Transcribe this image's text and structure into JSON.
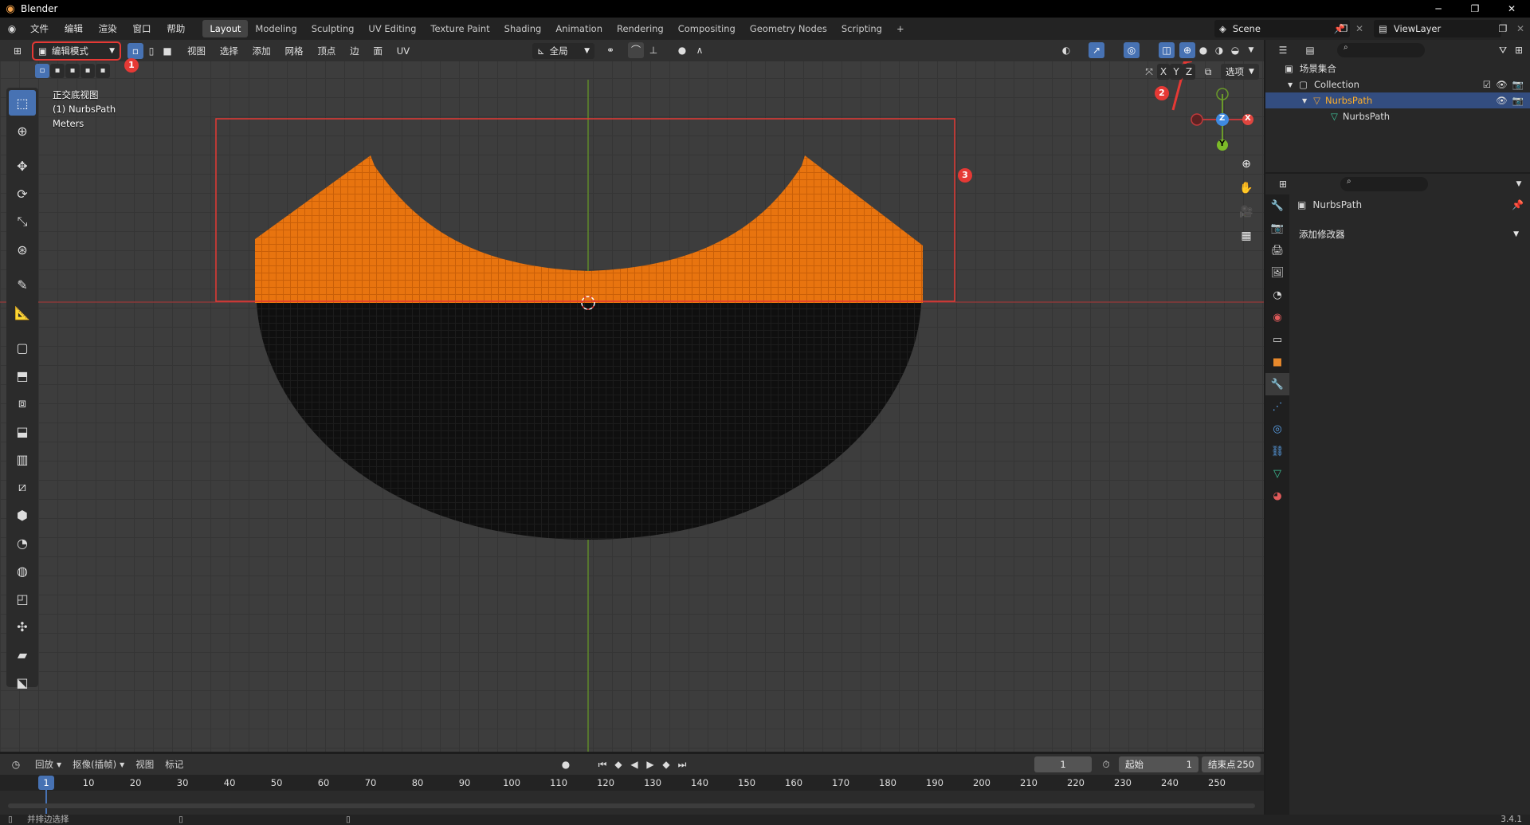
{
  "window": {
    "app_icon": "blender-logo-icon",
    "title": "Blender",
    "minimize": "─",
    "maximize": "❐",
    "close": "✕"
  },
  "menu": [
    "文件",
    "编辑",
    "渲染",
    "窗口",
    "帮助"
  ],
  "workspaces": [
    "Layout",
    "Modeling",
    "Sculpting",
    "UV Editing",
    "Texture Paint",
    "Shading",
    "Animation",
    "Rendering",
    "Compositing",
    "Geometry Nodes",
    "Scripting",
    "+"
  ],
  "scene": {
    "label": "Scene",
    "view_layer": "ViewLayer"
  },
  "viewport_header": {
    "mode": "编辑模式",
    "menus": [
      "视图",
      "选择",
      "添加",
      "网格",
      "顶点",
      "边",
      "面",
      "UV"
    ],
    "transform_orientation": "全局",
    "options": "选项",
    "axes": [
      "X",
      "Y",
      "Z"
    ]
  },
  "viewport_info": {
    "view": "正交底视图",
    "object": "(1) NurbsPath",
    "units": "Meters"
  },
  "gizmo": {
    "x": "X",
    "y": "Y",
    "z": "Z"
  },
  "annotations": [
    "1",
    "2",
    "3"
  ],
  "colors": {
    "selected": "#e8740f",
    "unselected": "#111111",
    "accent": "#4772b3",
    "annotation": "#e53935"
  },
  "timeline": {
    "playback": "回放",
    "keying": "抠像(插帧)",
    "view": "视图",
    "marker": "标记",
    "current_frame": "1",
    "start_label": "起始",
    "start": "1",
    "end_label": "结束点",
    "end": "250",
    "ruler": [
      "1",
      "10",
      "20",
      "30",
      "40",
      "50",
      "60",
      "70",
      "80",
      "90",
      "100",
      "110",
      "120",
      "130",
      "140",
      "150",
      "160",
      "170",
      "180",
      "190",
      "200",
      "210",
      "220",
      "230",
      "240",
      "250"
    ]
  },
  "status": {
    "left": "并排边选择",
    "version": "3.4.1"
  },
  "outliner": {
    "root": "场景集合",
    "collection": "Collection",
    "object": "NurbsPath",
    "mesh": "NurbsPath"
  },
  "properties": {
    "object_name": "NurbsPath",
    "add_modifier": "添加修改器"
  }
}
